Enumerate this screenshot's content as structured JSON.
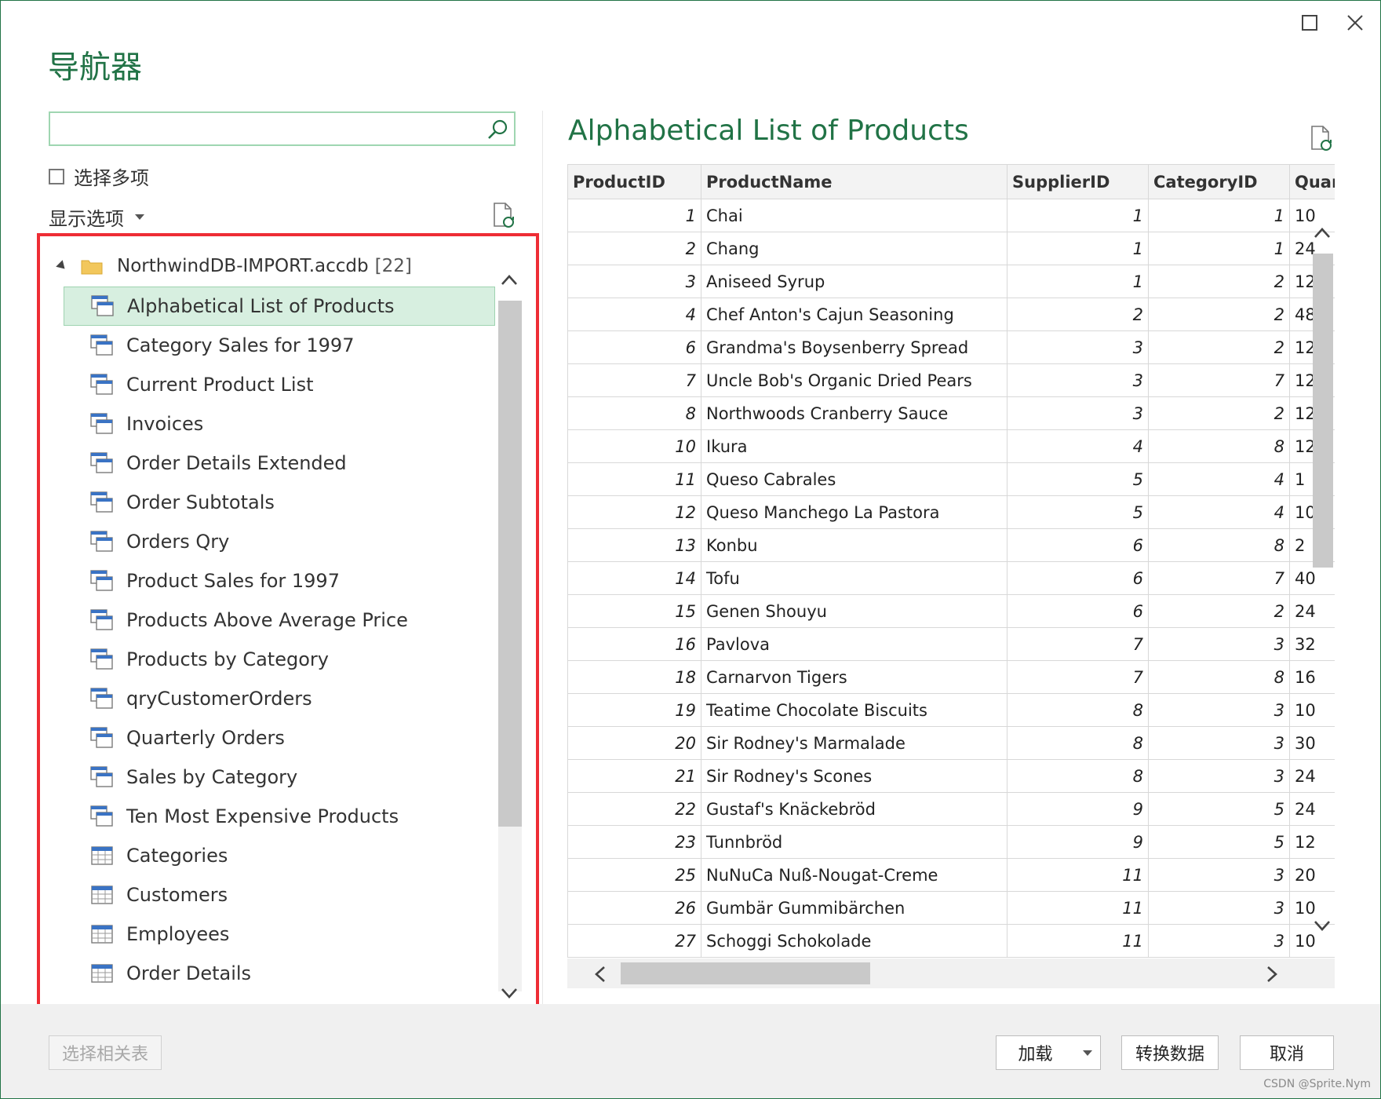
{
  "dialog": {
    "title": "导航器",
    "maximize_icon": "maximize-icon",
    "close_icon": "close-icon"
  },
  "left": {
    "search": {
      "value": "",
      "placeholder": ""
    },
    "select_multiple_label": "选择多项",
    "select_multiple_checked": false,
    "display_options_label": "显示选项",
    "root": {
      "label": "NorthwindDB-IMPORT.accdb",
      "count": "[22]"
    },
    "items": [
      {
        "label": "Alphabetical List of Products",
        "icon": "view-icon",
        "selected": true
      },
      {
        "label": "Category Sales for 1997",
        "icon": "view-icon"
      },
      {
        "label": "Current Product List",
        "icon": "view-icon"
      },
      {
        "label": "Invoices",
        "icon": "view-icon"
      },
      {
        "label": "Order Details Extended",
        "icon": "view-icon"
      },
      {
        "label": "Order Subtotals",
        "icon": "view-icon"
      },
      {
        "label": "Orders Qry",
        "icon": "view-icon"
      },
      {
        "label": "Product Sales for 1997",
        "icon": "view-icon"
      },
      {
        "label": "Products Above Average Price",
        "icon": "view-icon"
      },
      {
        "label": "Products by Category",
        "icon": "view-icon"
      },
      {
        "label": "qryCustomerOrders",
        "icon": "view-icon"
      },
      {
        "label": "Quarterly Orders",
        "icon": "view-icon"
      },
      {
        "label": "Sales by Category",
        "icon": "view-icon"
      },
      {
        "label": "Ten Most Expensive Products",
        "icon": "view-icon"
      },
      {
        "label": "Categories",
        "icon": "table-icon"
      },
      {
        "label": "Customers",
        "icon": "table-icon"
      },
      {
        "label": "Employees",
        "icon": "table-icon"
      },
      {
        "label": "Order Details",
        "icon": "table-icon"
      }
    ]
  },
  "preview": {
    "title": "Alphabetical List of Products",
    "columns": [
      "ProductID",
      "ProductName",
      "SupplierID",
      "CategoryID",
      "Quan"
    ],
    "rows": [
      [
        "1",
        "Chai",
        "1",
        "1",
        "10"
      ],
      [
        "2",
        "Chang",
        "1",
        "1",
        "24"
      ],
      [
        "3",
        "Aniseed Syrup",
        "1",
        "2",
        "12"
      ],
      [
        "4",
        "Chef Anton's Cajun Seasoning",
        "2",
        "2",
        "48"
      ],
      [
        "6",
        "Grandma's Boysenberry Spread",
        "3",
        "2",
        "12"
      ],
      [
        "7",
        "Uncle Bob's Organic Dried Pears",
        "3",
        "7",
        "12"
      ],
      [
        "8",
        "Northwoods Cranberry Sauce",
        "3",
        "2",
        "12"
      ],
      [
        "10",
        "Ikura",
        "4",
        "8",
        "12"
      ],
      [
        "11",
        "Queso Cabrales",
        "5",
        "4",
        "1"
      ],
      [
        "12",
        "Queso Manchego La Pastora",
        "5",
        "4",
        "10"
      ],
      [
        "13",
        "Konbu",
        "6",
        "8",
        "2"
      ],
      [
        "14",
        "Tofu",
        "6",
        "7",
        "40"
      ],
      [
        "15",
        "Genen Shouyu",
        "6",
        "2",
        "24"
      ],
      [
        "16",
        "Pavlova",
        "7",
        "3",
        "32"
      ],
      [
        "18",
        "Carnarvon Tigers",
        "7",
        "8",
        "16"
      ],
      [
        "19",
        "Teatime Chocolate Biscuits",
        "8",
        "3",
        "10"
      ],
      [
        "20",
        "Sir Rodney's Marmalade",
        "8",
        "3",
        "30"
      ],
      [
        "21",
        "Sir Rodney's Scones",
        "8",
        "3",
        "24"
      ],
      [
        "22",
        "Gustaf's Knäckebröd",
        "9",
        "5",
        "24"
      ],
      [
        "23",
        "Tunnbröd",
        "9",
        "5",
        "12"
      ],
      [
        "25",
        "NuNuCa Nuß-Nougat-Creme",
        "11",
        "3",
        "20"
      ],
      [
        "26",
        "Gumbär Gummibärchen",
        "11",
        "3",
        "10"
      ],
      [
        "27",
        "Schoggi Schokolade",
        "11",
        "3",
        "10"
      ]
    ]
  },
  "footer": {
    "select_related_label": "选择相关表",
    "load_label": "加载",
    "transform_label": "转换数据",
    "cancel_label": "取消",
    "watermark": "CSDN @Sprite.Nym"
  },
  "colors": {
    "accent": "#217346",
    "selected_bg": "#d7efe0",
    "highlight_border": "#ee2d35"
  }
}
